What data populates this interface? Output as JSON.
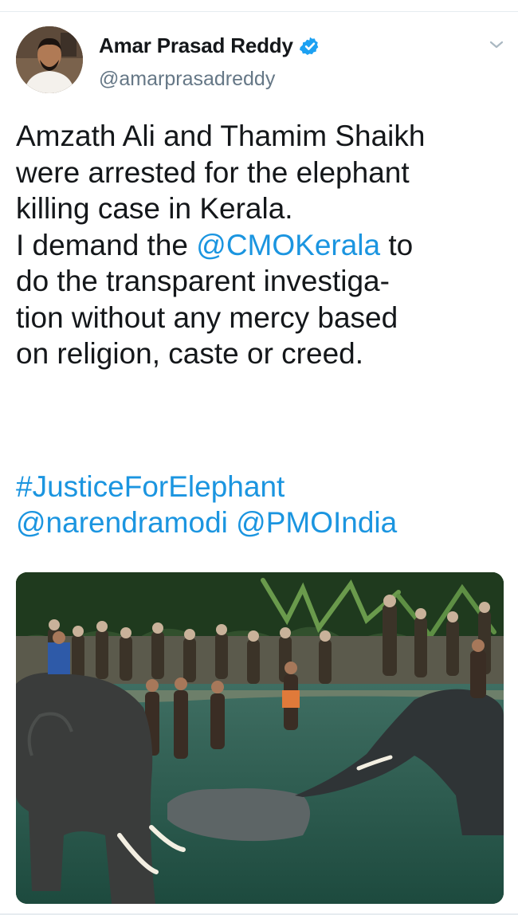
{
  "tweet": {
    "author_name": "Amar Prasad Reddy",
    "author_handle": "@amarprasadreddy",
    "text_line1": "Amzath Ali and Thamim Shaikh",
    "text_line2": "were arrested for the elephant",
    "text_line3": "killing case in Kerala.",
    "text_line4_pre": "I demand the ",
    "text_line4_mention": "@CMOKerala",
    "text_line4_post": " to",
    "text_line5": "do the transparent investiga-",
    "text_line6": "tion without any mercy based",
    "text_line7": "on religion, caste or creed.",
    "hashtag": "#JusticeForElephant",
    "mention_1": "@narendramodi",
    "mention_2": "@PMOIndia"
  },
  "colors": {
    "link": "#1b95e0",
    "verified": "#1da1f2",
    "text": "#14171a",
    "secondary": "#657786"
  },
  "icons": {
    "verified": "verified-badge-icon",
    "menu": "chevron-down-icon"
  }
}
